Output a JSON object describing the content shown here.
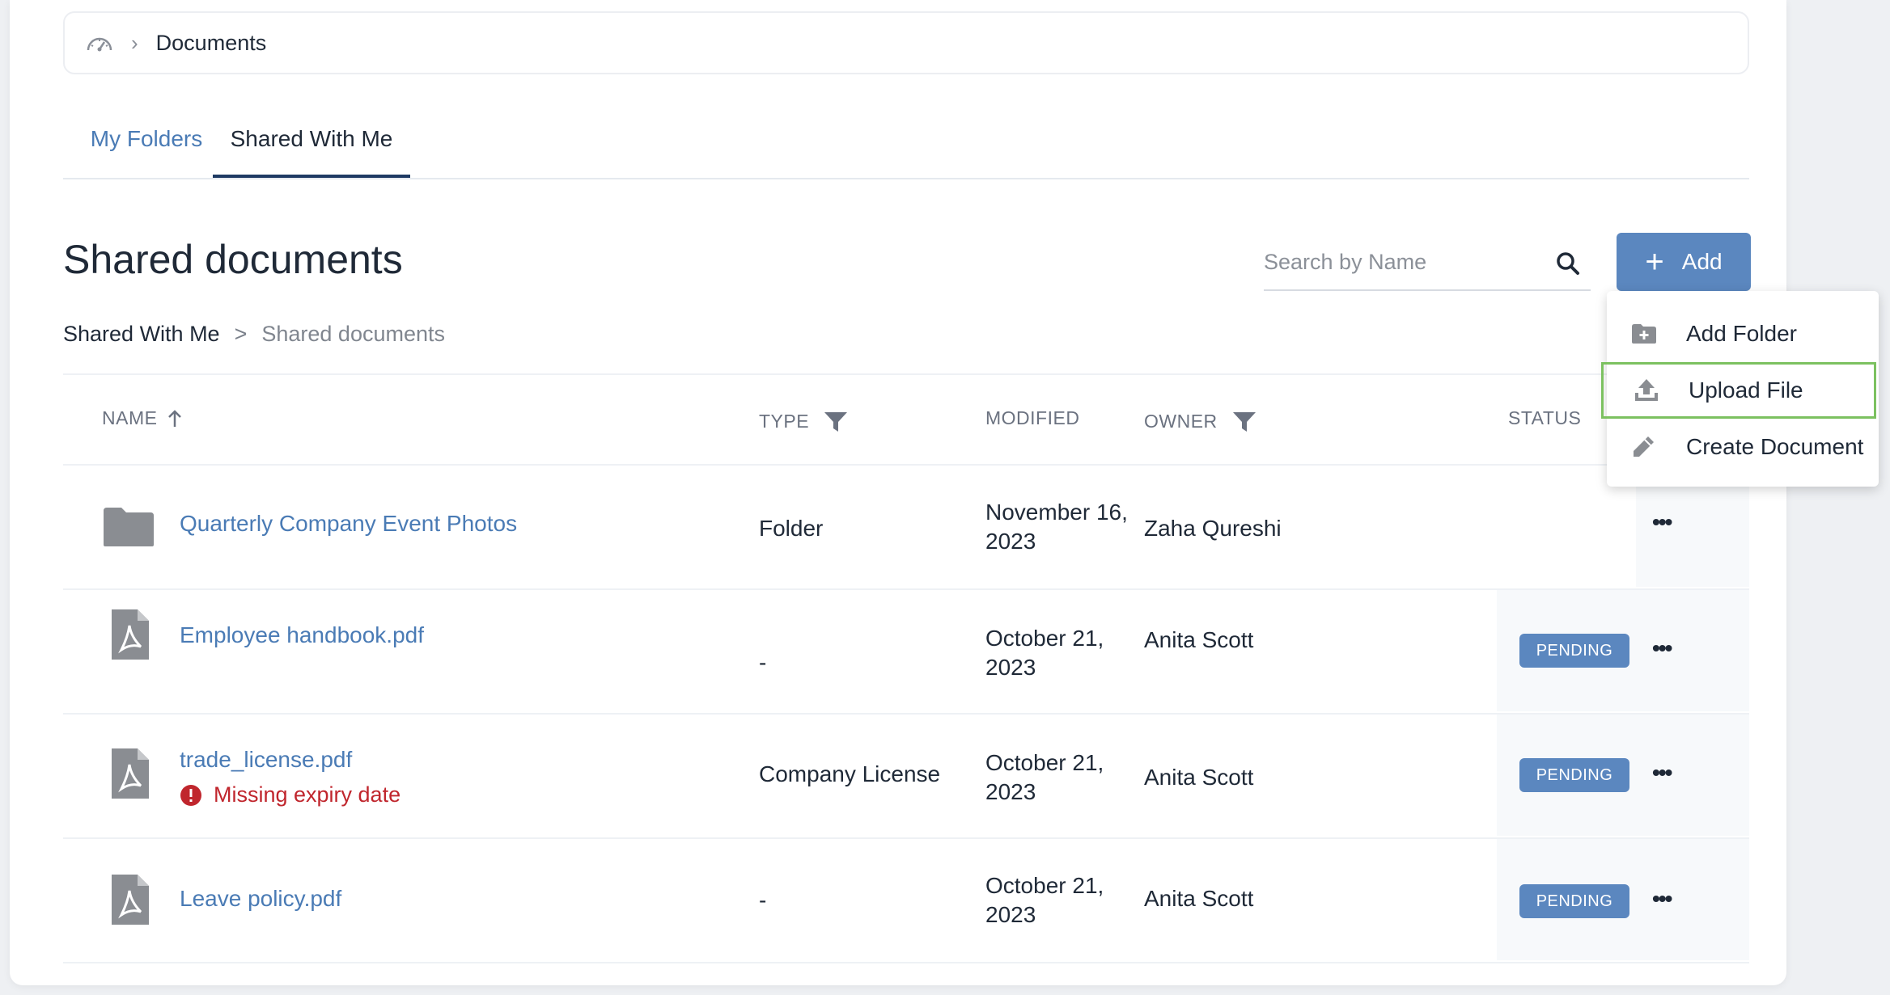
{
  "breadcrumb": {
    "home_icon": "dashboard-gauge-icon",
    "current": "Documents"
  },
  "tabs": [
    {
      "label": "My Folders",
      "active": false
    },
    {
      "label": "Shared With Me",
      "active": true
    }
  ],
  "page": {
    "title": "Shared documents"
  },
  "search": {
    "placeholder": "Search by Name",
    "value": ""
  },
  "add_button": {
    "label": "Add"
  },
  "path": {
    "parent": "Shared With Me",
    "separator": ">",
    "current": "Shared documents"
  },
  "table": {
    "headers": {
      "name": "NAME",
      "type": "TYPE",
      "modified": "MODIFIED",
      "owner": "OWNER",
      "status": "STATUS"
    },
    "rows": [
      {
        "icon": "folder-icon",
        "name": "Quarterly Company Event Photos",
        "error": "",
        "type": "Folder",
        "modified_line1": "November 16,",
        "modified_line2": "2023",
        "owner": "Zaha Qureshi",
        "status": ""
      },
      {
        "icon": "pdf-file-icon",
        "name": "Employee handbook.pdf",
        "error": "",
        "type": "-",
        "modified_line1": "October 21,",
        "modified_line2": "2023",
        "owner": "Anita Scott",
        "status": "PENDING"
      },
      {
        "icon": "pdf-file-icon",
        "name": "trade_license.pdf",
        "error": "Missing expiry date",
        "type": "Company License",
        "modified_line1": "October 21,",
        "modified_line2": "2023",
        "owner": "Anita Scott",
        "status": "PENDING"
      },
      {
        "icon": "pdf-file-icon",
        "name": "Leave policy.pdf",
        "error": "",
        "type": "-",
        "modified_line1": "October 21,",
        "modified_line2": "2023",
        "owner": "Anita Scott",
        "status": "PENDING"
      }
    ]
  },
  "add_menu": {
    "items": [
      {
        "label": "Add Folder",
        "icon": "folder-plus-icon"
      },
      {
        "label": "Upload File",
        "icon": "upload-icon",
        "highlighted": true
      },
      {
        "label": "Create Document",
        "icon": "pencil-icon"
      }
    ]
  },
  "colors": {
    "accent": "#5b87bf",
    "link": "#4a7bb5",
    "error": "#c0262d",
    "highlight": "#7cc160"
  }
}
